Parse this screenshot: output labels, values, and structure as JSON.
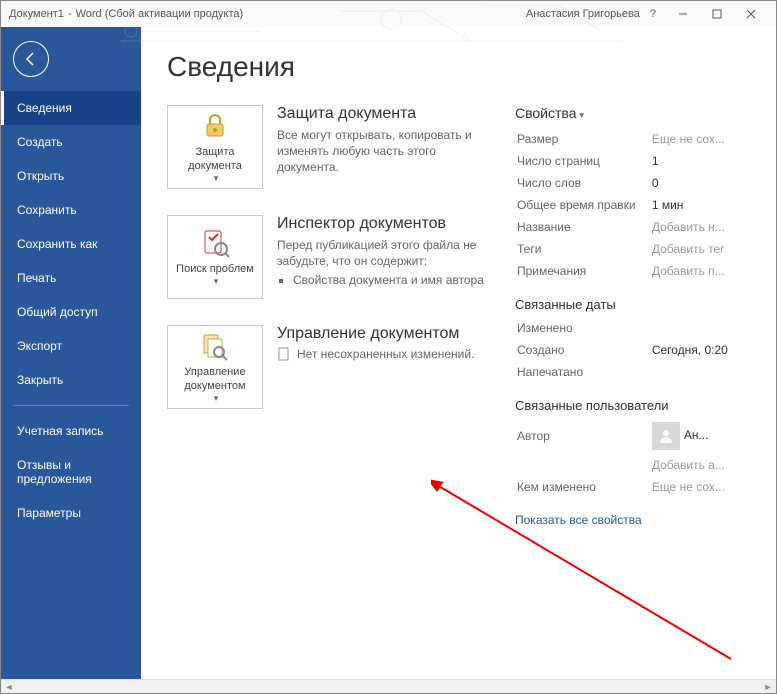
{
  "titlebar": {
    "document": "Документ1",
    "app": "Word (Сбой активации продукта)",
    "user": "Анастасия Григорьева",
    "help": "?"
  },
  "sidebar": {
    "items": [
      "Сведения",
      "Создать",
      "Открыть",
      "Сохранить",
      "Сохранить как",
      "Печать",
      "Общий доступ",
      "Экспорт",
      "Закрыть"
    ],
    "footer_items": [
      "Учетная запись",
      "Отзывы и предложения",
      "Параметры"
    ]
  },
  "page": {
    "title": "Сведения"
  },
  "sections": {
    "protect": {
      "button": "Защита документа",
      "heading": "Защита документа",
      "text": "Все могут открывать, копировать и изменять любую часть этого документа."
    },
    "inspect": {
      "button": "Поиск проблем",
      "heading": "Инспектор документов",
      "text": "Перед публикацией этого файла не забудьте, что он содержит:",
      "bullet": "Свойства документа и имя автора"
    },
    "manage": {
      "button": "Управление документом",
      "heading": "Управление документом",
      "text": "Нет несохраненных изменений."
    }
  },
  "properties": {
    "heading": "Свойства",
    "rows": [
      {
        "k": "Размер",
        "v": "Еще не сох...",
        "p": true
      },
      {
        "k": "Число страниц",
        "v": "1"
      },
      {
        "k": "Число слов",
        "v": "0"
      },
      {
        "k": "Общее время правки",
        "v": "1 мин"
      },
      {
        "k": "Название",
        "v": "Добавить н...",
        "p": true
      },
      {
        "k": "Теги",
        "v": "Добавить тег",
        "p": true
      },
      {
        "k": "Примечания",
        "v": "Добавить п...",
        "p": true
      }
    ],
    "dates_heading": "Связанные даты",
    "dates": [
      {
        "k": "Изменено",
        "v": ""
      },
      {
        "k": "Создано",
        "v": "Сегодня, 0:20"
      },
      {
        "k": "Напечатано",
        "v": ""
      }
    ],
    "users_heading": "Связанные пользователи",
    "author_label": "Автор",
    "author_value": "Ан...",
    "add_author": "Добавить а...",
    "modified_by_label": "Кем изменено",
    "modified_by_value": "Еще не сох...",
    "show_all": "Показать все свойства"
  }
}
